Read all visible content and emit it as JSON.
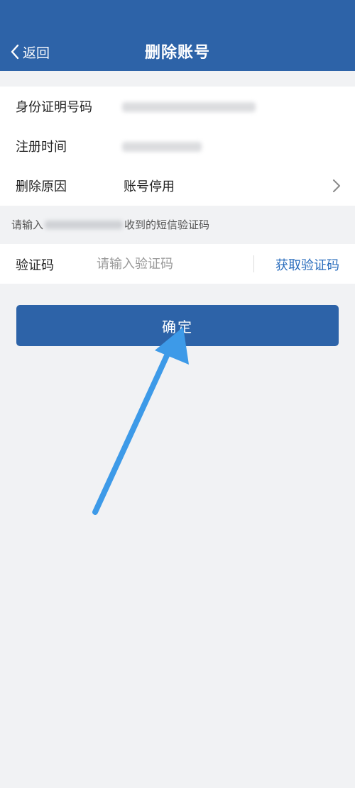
{
  "header": {
    "back_label": "返回",
    "title": "删除账号"
  },
  "form": {
    "id_label": "身份证明号码",
    "register_label": "注册时间",
    "reason_label": "删除原因",
    "reason_value": "账号停用"
  },
  "hint": {
    "prefix": "请输入",
    "suffix": "收到的短信验证码"
  },
  "verify": {
    "label": "验证码",
    "placeholder": "请输入验证码",
    "get_code_label": "获取验证码"
  },
  "confirm_label": "确定",
  "colors": {
    "header_bg": "#2d63a8",
    "link": "#2a6dbd",
    "annotation_arrow": "#3d9ae8"
  }
}
